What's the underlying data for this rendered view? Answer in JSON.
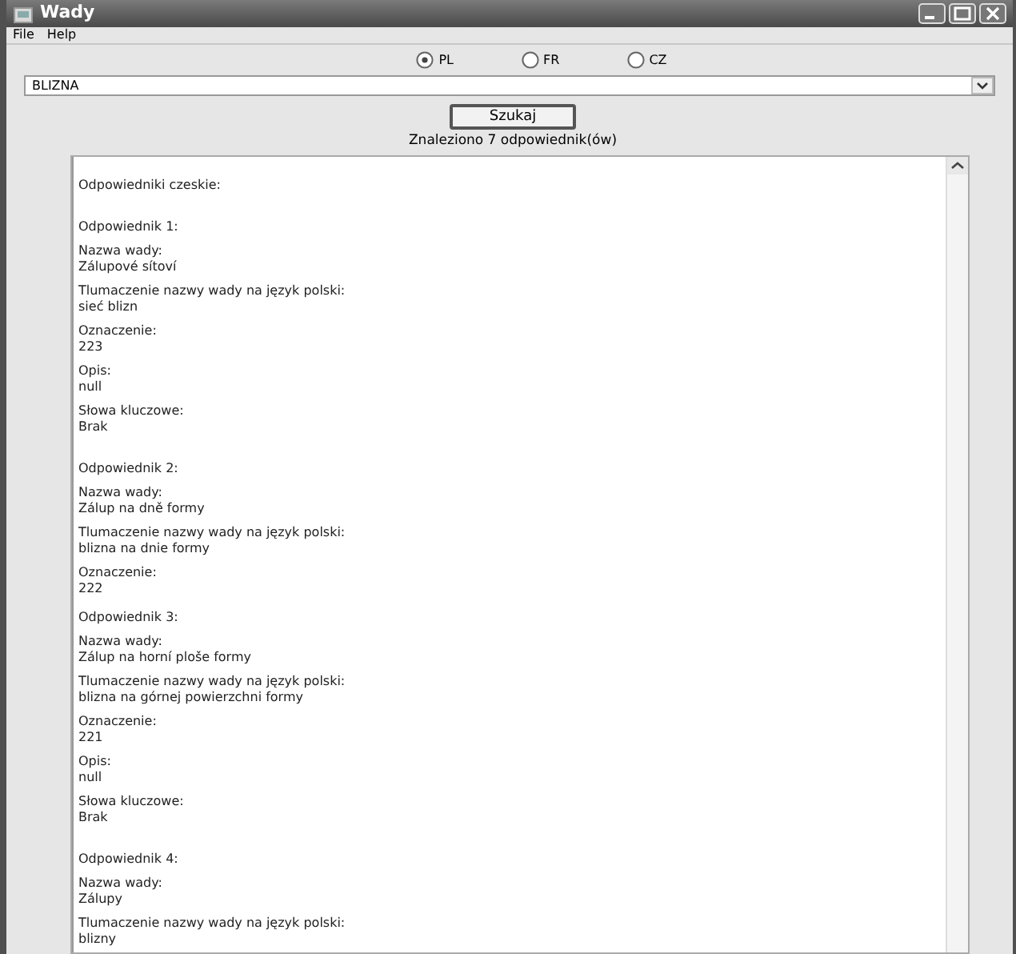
{
  "window": {
    "title": "Wady"
  },
  "menu": [
    "File",
    "Help"
  ],
  "languages": [
    {
      "label": "PL",
      "selected": true
    },
    {
      "label": "FR",
      "selected": false
    },
    {
      "label": "CZ",
      "selected": false
    }
  ],
  "search": {
    "value": "BLIZNA"
  },
  "search_button": "Szukaj",
  "result": "Znaleziono 7 odpowiednik(ów)",
  "blocks": [
    {
      "kind": "heading",
      "spaced_before": false,
      "lines": [
        "Odpowiedniki czeskie:"
      ]
    },
    {
      "kind": "heading",
      "spaced_before": true,
      "lines": [
        "Odpowiednik 1:"
      ]
    },
    {
      "kind": "field",
      "lines": [
        "Nazwa wady:",
        "Zálupové sítoví"
      ]
    },
    {
      "kind": "field",
      "lines": [
        "Tlumaczenie nazwy wady na język polski:",
        "sieć blizn"
      ]
    },
    {
      "kind": "field",
      "lines": [
        "Oznaczenie:",
        "223"
      ]
    },
    {
      "kind": "field",
      "lines": [
        "Opis:",
        "null"
      ]
    },
    {
      "kind": "field",
      "lines": [
        "Słowa kluczowe:",
        "Brak"
      ]
    },
    {
      "kind": "heading",
      "spaced_before": true,
      "lines": [
        "Odpowiednik 2:"
      ]
    },
    {
      "kind": "field",
      "lines": [
        "Nazwa wady:",
        "Zálup na dně formy"
      ]
    },
    {
      "kind": "field",
      "lines": [
        "Tlumaczenie nazwy wady na język polski:",
        "blizna na dnie formy"
      ]
    },
    {
      "kind": "field",
      "lines": [
        "Oznaczenie:",
        "222"
      ]
    },
    {
      "kind": "heading",
      "spaced_before": false,
      "lines": [
        "Odpowiednik 3:"
      ]
    },
    {
      "kind": "field",
      "lines": [
        "Nazwa wady:",
        "Zálup na horní ploše formy"
      ]
    },
    {
      "kind": "field",
      "lines": [
        "Tlumaczenie nazwy wady na język polski:",
        "blizna na górnej powierzchni formy"
      ]
    },
    {
      "kind": "field",
      "lines": [
        "Oznaczenie:",
        "221"
      ]
    },
    {
      "kind": "field",
      "lines": [
        "Opis:",
        "null"
      ]
    },
    {
      "kind": "field",
      "lines": [
        "Słowa kluczowe:",
        "Brak"
      ]
    },
    {
      "kind": "heading",
      "spaced_before": true,
      "lines": [
        "Odpowiednik 4:"
      ]
    },
    {
      "kind": "field",
      "lines": [
        "Nazwa wady:",
        "Zálupy"
      ]
    },
    {
      "kind": "field",
      "lines": [
        "Tlumaczenie nazwy wady na język polski:",
        "blizny"
      ]
    }
  ]
}
